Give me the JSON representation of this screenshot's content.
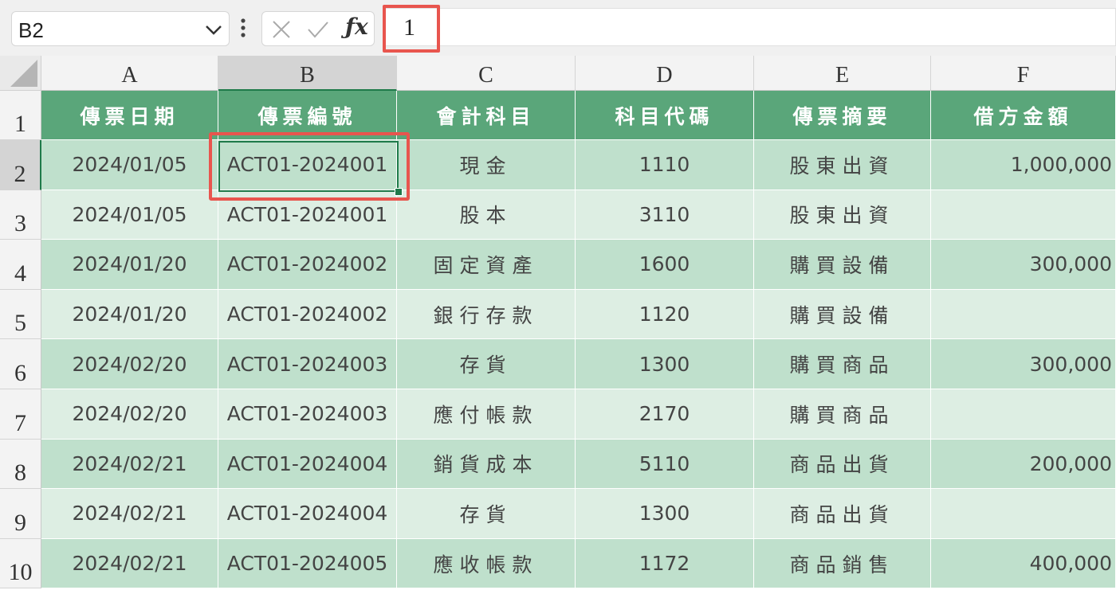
{
  "name_box": {
    "value": "B2"
  },
  "formula": {
    "value": "1"
  },
  "columns": [
    "A",
    "B",
    "C",
    "D",
    "E",
    "F"
  ],
  "rows": [
    "1",
    "2",
    "3",
    "4",
    "5",
    "6",
    "7",
    "8",
    "9",
    "10"
  ],
  "headers": [
    "傳票日期",
    "傳票編號",
    "會計科目",
    "科目代碼",
    "傳票摘要",
    "借方金額"
  ],
  "data": [
    [
      "2024/01/05",
      "ACT01-2024001",
      "現金",
      "1110",
      "股東出資",
      "1,000,000"
    ],
    [
      "2024/01/05",
      "ACT01-2024001",
      "股本",
      "3110",
      "股東出資",
      ""
    ],
    [
      "2024/01/20",
      "ACT01-2024002",
      "固定資產",
      "1600",
      "購買設備",
      "300,000"
    ],
    [
      "2024/01/20",
      "ACT01-2024002",
      "銀行存款",
      "1120",
      "購買設備",
      ""
    ],
    [
      "2024/02/20",
      "ACT01-2024003",
      "存貨",
      "1300",
      "購買商品",
      "300,000"
    ],
    [
      "2024/02/20",
      "ACT01-2024003",
      "應付帳款",
      "2170",
      "購買商品",
      ""
    ],
    [
      "2024/02/21",
      "ACT01-2024004",
      "銷貨成本",
      "5110",
      "商品出貨",
      "200,000"
    ],
    [
      "2024/02/21",
      "ACT01-2024004",
      "存貨",
      "1300",
      "商品出貨",
      ""
    ],
    [
      "2024/02/21",
      "ACT01-2024005",
      "應收帳款",
      "1172",
      "商品銷售",
      "400,000"
    ]
  ],
  "colors": {
    "header_fill": "#5aa67a",
    "band_dark": "#bfe0cc",
    "band_light": "#ddeee3",
    "selection": "#1f7a4a",
    "highlight_box": "#e8554e"
  },
  "icons": {
    "name_box_dropdown": "chevron-down-icon",
    "more": "vertical-dots-icon",
    "cancel": "x-icon",
    "enter": "check-icon",
    "function": "fx-icon",
    "select_all": "select-all-triangle-icon"
  },
  "selected_column": "B",
  "selected_row": "2"
}
